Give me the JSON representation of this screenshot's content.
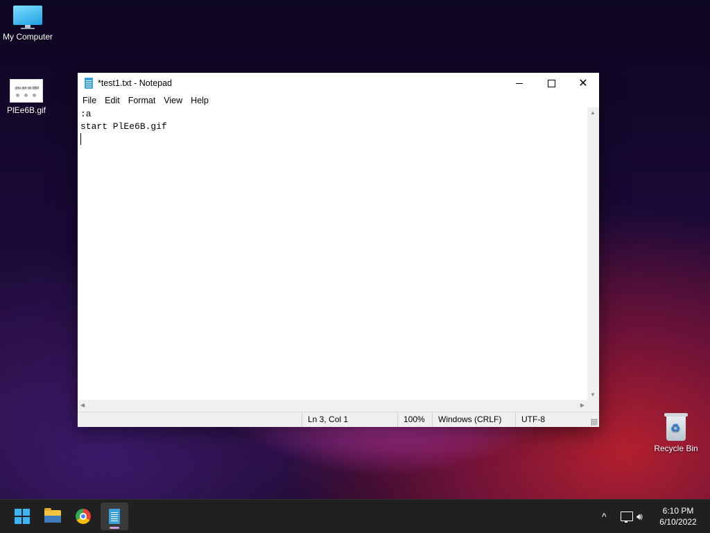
{
  "desktop": {
    "icons": [
      {
        "label": "My Computer",
        "icon": "monitor-icon"
      },
      {
        "label": "PlEe6B.gif",
        "icon": "gif-thumbnail-icon",
        "thumb_text": "you are an idiot"
      },
      {
        "label": "Recycle Bin",
        "icon": "recycle-bin-icon"
      }
    ]
  },
  "notepad": {
    "title": "*test1.txt - Notepad",
    "menu": [
      "File",
      "Edit",
      "Format",
      "View",
      "Help"
    ],
    "lines": [
      ":a",
      "start PlEe6B.gif",
      ""
    ],
    "status": {
      "position": "Ln 3, Col 1",
      "zoom": "100%",
      "line_ending": "Windows (CRLF)",
      "encoding": "UTF-8"
    },
    "controls": {
      "minimize": "minimize",
      "maximize": "maximize",
      "close": "close"
    }
  },
  "taskbar": {
    "apps": [
      {
        "name": "start",
        "icon": "windows-start-icon"
      },
      {
        "name": "file-explorer",
        "icon": "folder-icon"
      },
      {
        "name": "chrome",
        "icon": "chrome-icon"
      },
      {
        "name": "notepad",
        "icon": "notepad-icon",
        "active": true
      }
    ],
    "tray": {
      "chevron": "^",
      "time": "6:10 PM",
      "date": "6/10/2022"
    }
  },
  "colors": {
    "accent": "#3cb5f5",
    "taskbar_bg": "#202020"
  }
}
